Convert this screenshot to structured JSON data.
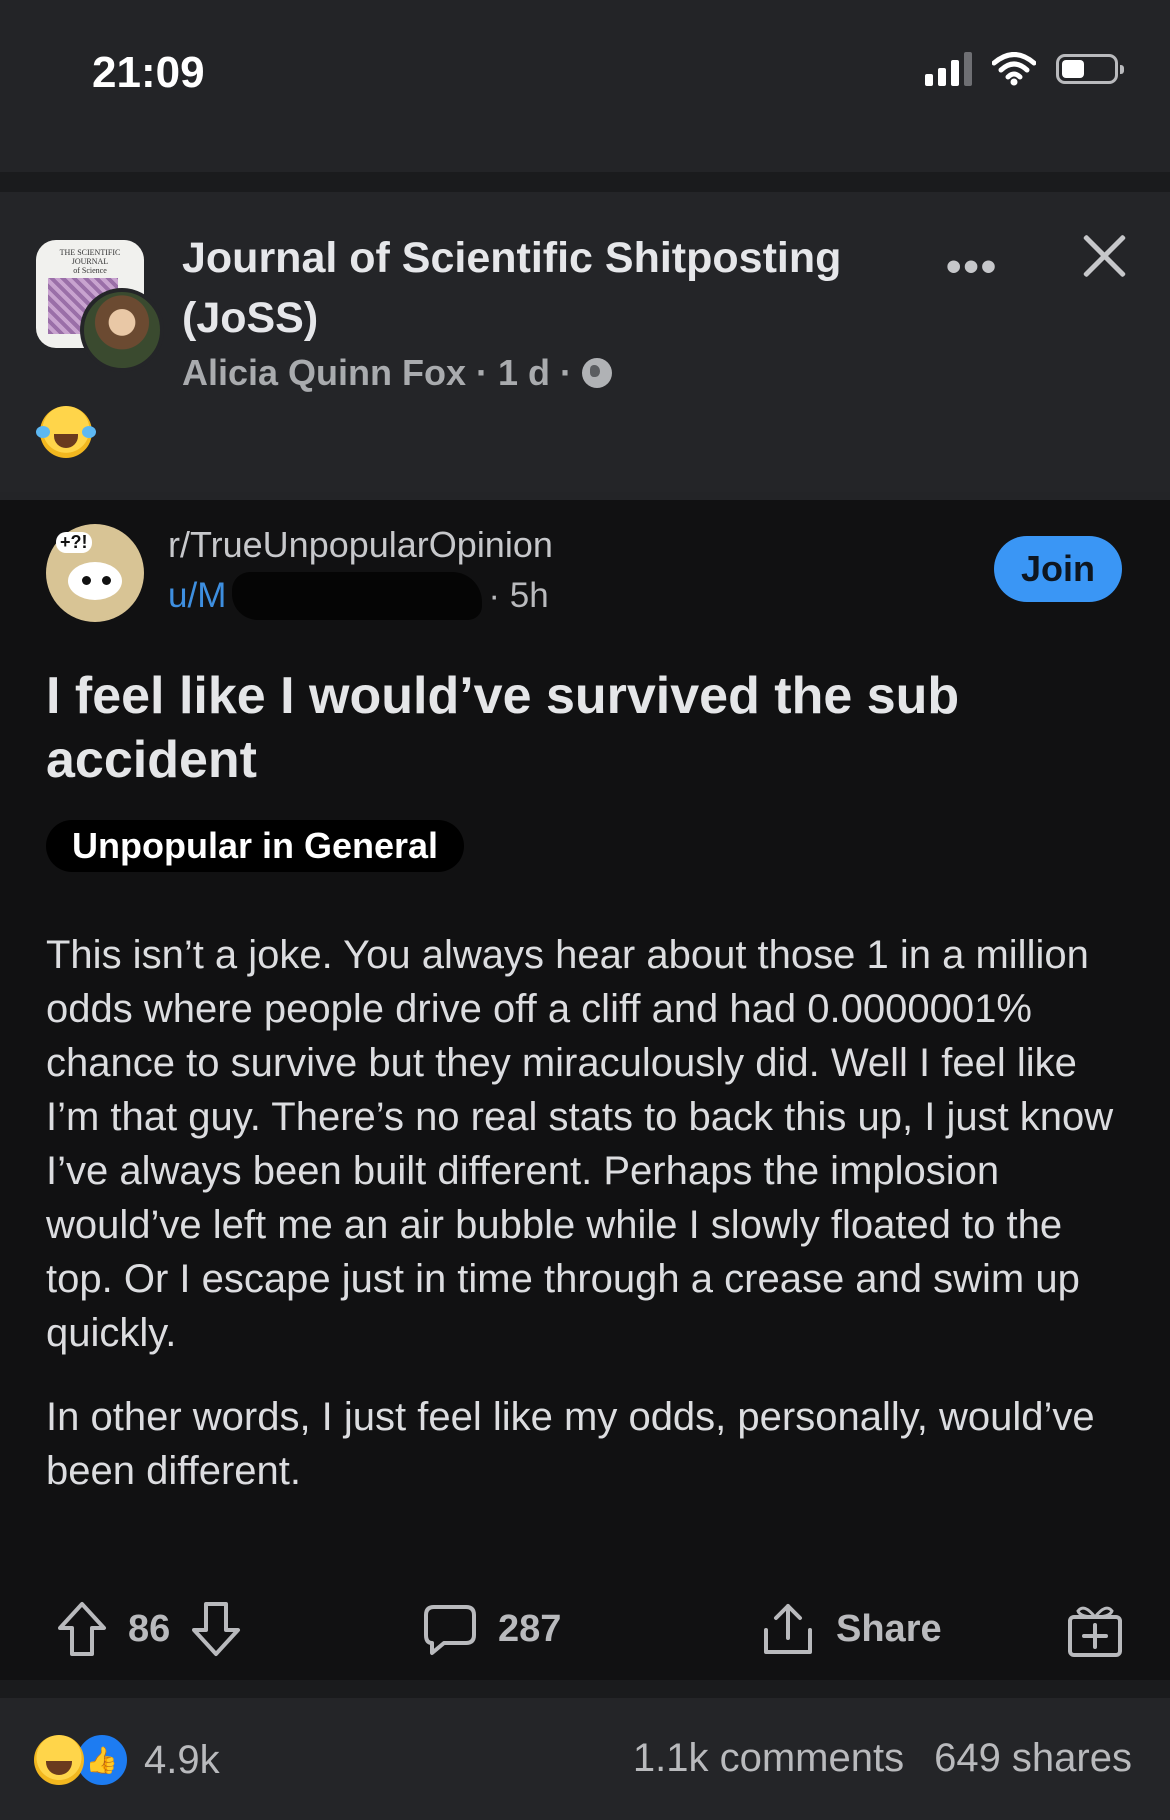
{
  "status_bar": {
    "time": "21:09"
  },
  "post": {
    "group_name": "Journal of Scientific Shitposting (JoSS)",
    "author": "Alicia Quinn Fox",
    "age": "1 d",
    "avatar_text": "THE SCIENTIFIC JOURNAL of Science"
  },
  "reddit": {
    "subreddit": "r/TrueUnpopularOpinion",
    "user_prefix": "u/M",
    "age": "· 5h",
    "join_label": "Join",
    "title": "I feel like I would’ve survived the sub accident",
    "flair": "Unpopular in General",
    "body": [
      "This isn’t a joke. You always hear about those 1 in a million odds where people drive off a cliff and had 0.0000001% chance to survive but they miraculously did. Well I feel like I’m that guy. There’s no real stats to back this up, I just know I’ve always been built different. Perhaps the implosion would’ve left me an air bubble while I slowly floated to the top. Or I escape just in time through a crease and swim up quickly.",
      "In other words, I just feel like my odds, personally, would’ve been different."
    ],
    "votes": "86",
    "comments": "287",
    "share_label": "Share"
  },
  "footer": {
    "reaction_count": "4.9k",
    "comments": "1.1k comments",
    "shares": "649 shares"
  }
}
